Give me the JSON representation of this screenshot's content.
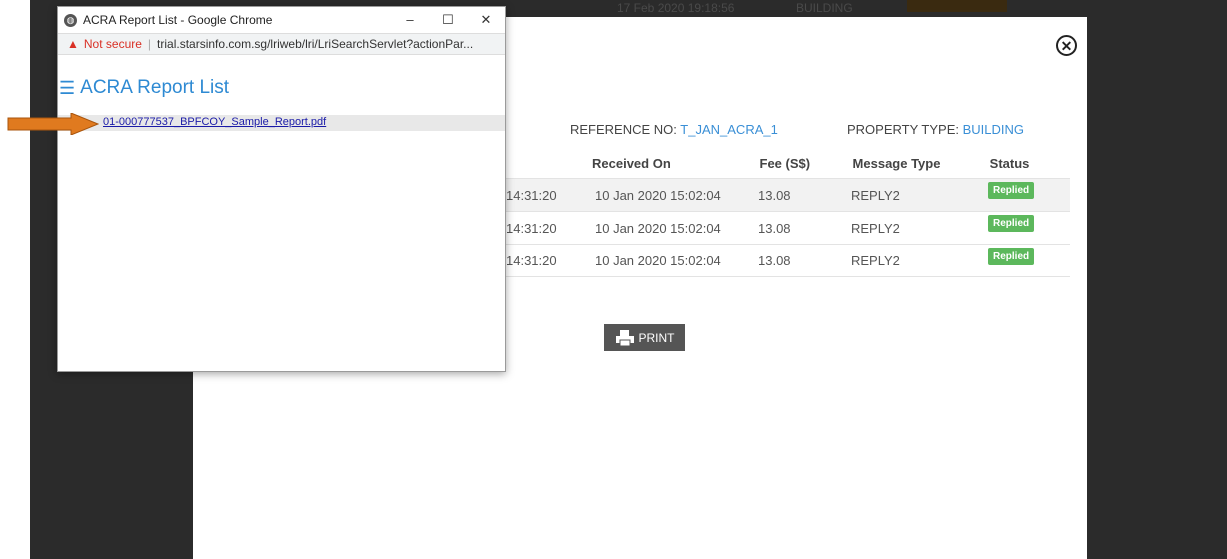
{
  "background": {
    "date": "17 Feb 2020 19:18:56",
    "type": "BUILDING"
  },
  "modal": {
    "reference_label": "REFERENCE NO:",
    "reference_value": "T_JAN_ACRA_1",
    "property_label": "PROPERTY TYPE:",
    "property_value": "BUILDING",
    "table": {
      "headers": [
        "Received On",
        "Fee (S$)",
        "Message Type",
        "Status"
      ],
      "rows": [
        {
          "sent": "14:31:20",
          "received": "10 Jan 2020 15:02:04",
          "fee": "13.08",
          "message_type": "REPLY2",
          "status": "Replied"
        },
        {
          "sent": "14:31:20",
          "received": "10 Jan 2020 15:02:04",
          "fee": "13.08",
          "message_type": "REPLY2",
          "status": "Replied"
        },
        {
          "sent": "14:31:20",
          "received": "10 Jan 2020 15:02:04",
          "fee": "13.08",
          "message_type": "REPLY2",
          "status": "Replied"
        }
      ]
    },
    "print_label": "PRINT"
  },
  "popup": {
    "window_title": "ACRA Report List - Google Chrome",
    "controls": [
      "–",
      "☐",
      "✕"
    ],
    "not_secure": "Not secure",
    "url": "trial.starsinfo.com.sg/lriweb/lri/LriSearchServlet?actionPar...",
    "page_title": "ACRA Report List",
    "report_link": "01-000777537_BPFCOY_Sample_Report.pdf"
  },
  "colors": {
    "accent": "#2e8ad3",
    "badge": "#5cb85c",
    "arrow": "#e07a1f",
    "warning": "#d93025"
  }
}
